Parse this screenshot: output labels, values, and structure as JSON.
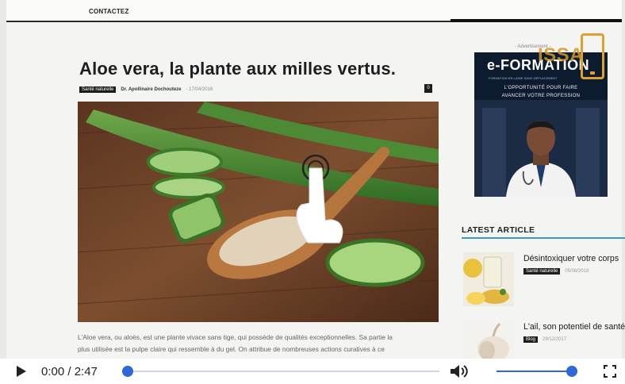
{
  "site": {
    "nav_link": "CONTACTEZ"
  },
  "article": {
    "title": "Aloe vera, la plante aux milles vertus.",
    "category": "Santé naturelle",
    "author": "Dr. Apollinaire Dochouteze",
    "date": "17/04/2016",
    "comments_count": "0",
    "hero_image": "aloe-vera-gel-on-wooden-spoon",
    "body_lines": [
      "L'Aloe vera, ou aloès, est une plante vivace sans tige, qui possède de qualités exceptionnelles. Sa partie la",
      "plus utilisée est la pulpe claire qui ressemble à du gel. On attribue de nombreuses actions curatives à ce"
    ]
  },
  "sidebar": {
    "ad_label": "- Advertisement -",
    "ad": {
      "brand": "e-FORMATION",
      "small_text": "FORMATION EN LIGNE SANS DÉPLACEMENT",
      "line1": "L'OPPORTUNITÉ POUR FAIRE",
      "line2": "AVANCER VOTRE PROFESSION",
      "overlay_logo": "ISSA"
    },
    "latest_title": "LATEST ARTICLE",
    "latest": [
      {
        "title": "Désintoxiquer votre corps",
        "badge": "Santé naturelle",
        "date": "05/08/2018",
        "thumb": "detox-drinks"
      },
      {
        "title": "L'ail, son potentiel de santé",
        "badge": "Blog",
        "date": "29/12/2017",
        "thumb": "garlic"
      }
    ]
  },
  "player": {
    "time_display": "0:00 / 2:47",
    "progress": 0.0,
    "volume": 1.0,
    "accent_color": "#2f67d8"
  }
}
